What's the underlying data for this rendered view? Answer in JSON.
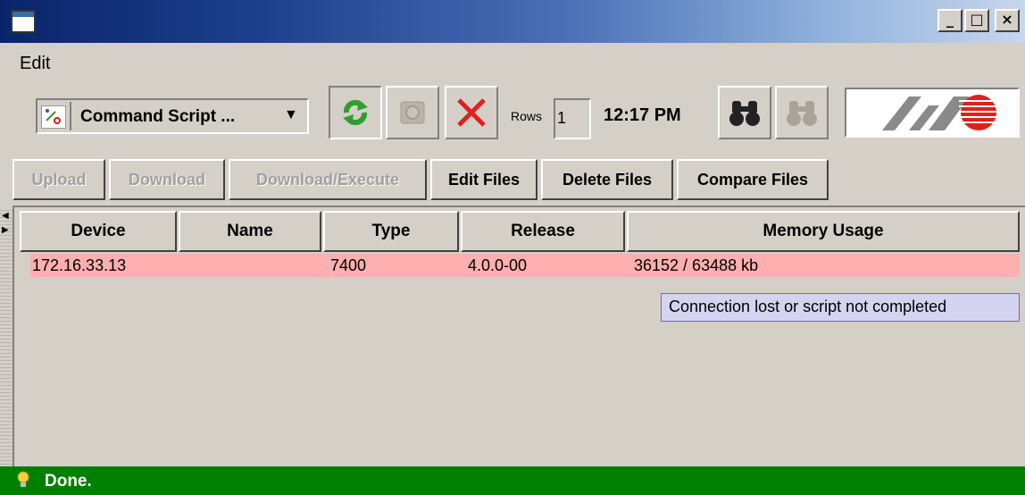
{
  "menu": {
    "edit": "Edit"
  },
  "toolbar": {
    "mode_combo": "Command Script ...",
    "rows_label": "Rows",
    "rows_value": "1",
    "time": "12:17 PM"
  },
  "actions": {
    "upload": "Upload",
    "download": "Download",
    "download_execute": "Download/Execute",
    "edit_files": "Edit Files",
    "delete_files": "Delete Files",
    "compare_files": "Compare Files"
  },
  "table": {
    "columns": [
      "Device",
      "Name",
      "Type",
      "Release",
      "Memory Usage"
    ],
    "rows": [
      {
        "device": "172.16.33.13",
        "name": "",
        "type": "7400",
        "release": "4.0.0-00",
        "memory": "36152 / 63488 kb"
      }
    ]
  },
  "tooltip": "Connection lost or script not completed",
  "status": "Done.",
  "colors": {
    "row_error": "#ffafaf",
    "status_bar": "#008000",
    "refresh_icon": "#2e9e2e",
    "stop_icon": "#e02020",
    "logo_red": "#e02020"
  }
}
